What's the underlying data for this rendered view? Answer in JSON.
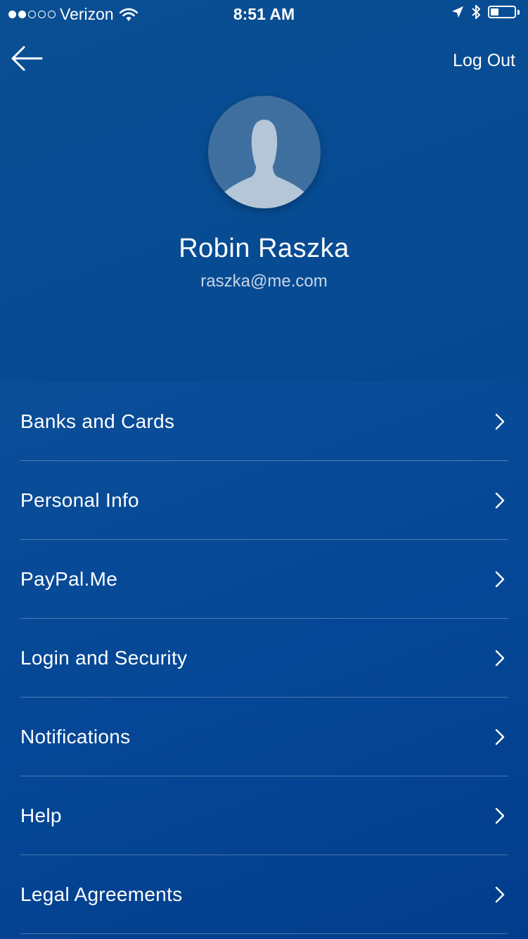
{
  "status_bar": {
    "carrier": "Verizon",
    "signal_filled": 2,
    "signal_total": 5,
    "time": "8:51 AM",
    "battery_level": 0.35
  },
  "header": {
    "back_icon": "arrow-left-icon",
    "logout_label": "Log Out"
  },
  "profile": {
    "name": "Robin Raszka",
    "email": "raszka@me.com",
    "avatar_icon": "person-silhouette-icon"
  },
  "menu": {
    "items": [
      {
        "label": "Banks and Cards"
      },
      {
        "label": "Personal Info"
      },
      {
        "label": "PayPal.Me"
      },
      {
        "label": "Login and Security"
      },
      {
        "label": "Notifications"
      },
      {
        "label": "Help"
      },
      {
        "label": "Legal Agreements"
      }
    ]
  },
  "colors": {
    "background": "#064a93",
    "text": "#ffffff",
    "email_text": "#c9d6e6",
    "avatar_bg": "#3f6f9f",
    "avatar_figure": "#b5c6d8"
  }
}
